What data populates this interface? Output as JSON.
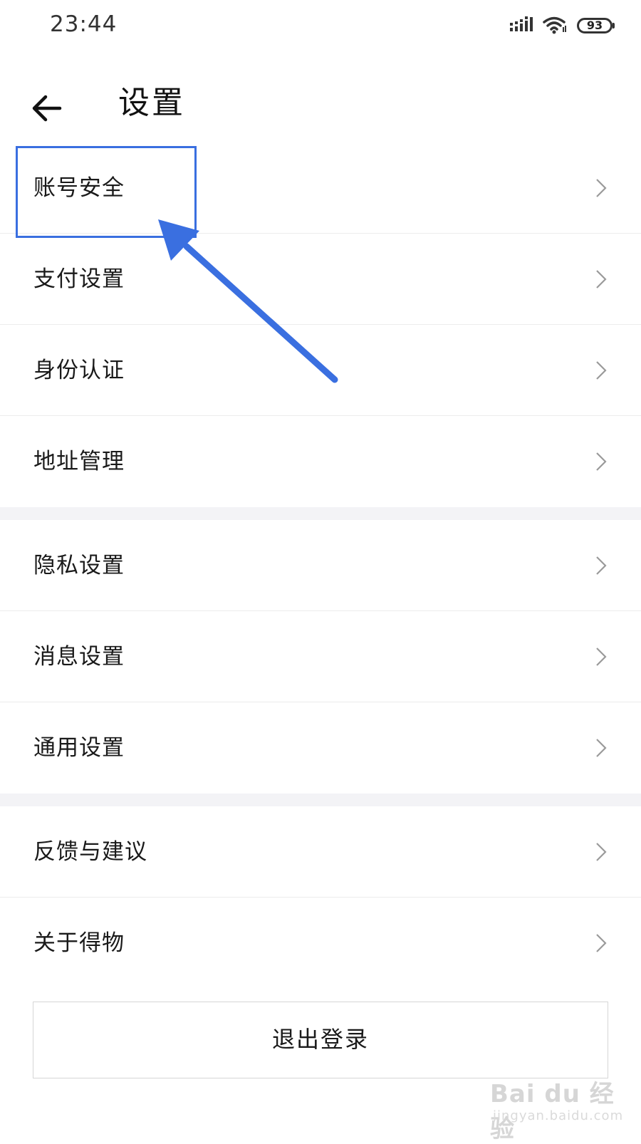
{
  "status_bar": {
    "time": "23:44",
    "battery": "93",
    "icons": [
      "signal-icon",
      "wifi-icon",
      "battery-icon"
    ]
  },
  "header": {
    "title": "设置",
    "back_icon": "back-arrow-icon"
  },
  "groups": [
    {
      "items": [
        {
          "label": "账号安全",
          "icon": "chevron-right-icon"
        },
        {
          "label": "支付设置",
          "icon": "chevron-right-icon"
        },
        {
          "label": "身份认证",
          "icon": "chevron-right-icon"
        },
        {
          "label": "地址管理",
          "icon": "chevron-right-icon"
        }
      ]
    },
    {
      "items": [
        {
          "label": "隐私设置",
          "icon": "chevron-right-icon"
        },
        {
          "label": "消息设置",
          "icon": "chevron-right-icon"
        },
        {
          "label": "通用设置",
          "icon": "chevron-right-icon"
        }
      ]
    },
    {
      "items": [
        {
          "label": "反馈与建议",
          "icon": "chevron-right-icon"
        },
        {
          "label": "关于得物",
          "icon": "chevron-right-icon"
        }
      ]
    }
  ],
  "logout_label": "退出登录",
  "annotation": {
    "highlight_target": "账号安全",
    "color": "#3a6fe0"
  },
  "watermark": {
    "main": "Bai du 经验",
    "sub": "jingyan.baidu.com"
  }
}
